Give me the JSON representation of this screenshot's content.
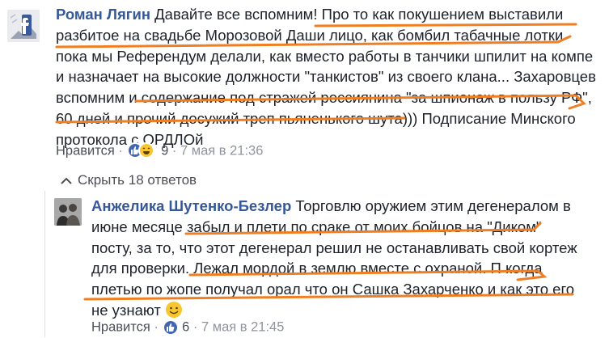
{
  "comment1": {
    "author": "Роман Лягин",
    "lines": [
      "Давайте все вспомним! Про то как покушением выставили",
      "разбитое на свадьбе Морозовой Даши лицо, как бомбил табачные лотки",
      "пока мы Референдум делали, как вместо работы в танчики шпилит на компе",
      "и назначает на высокие должности \"танкистов\" из своего клана... Захаровцев",
      "вспомним и содержание под стражей россиянина \"за шпионаж в пользу РФ\",",
      "60 дней и прочий досужий треп пьяненького шута))) Подписание Минского",
      "протокола с ОРДЛОй"
    ],
    "like_label": "Нравится",
    "reaction_count": "9",
    "separator": "·",
    "timestamp": "7 мая в 21:36"
  },
  "replies_toggle": {
    "label": "Скрыть 18 ответов"
  },
  "comment2": {
    "author": "Анжелика Шутенко-Безлер",
    "lines": [
      "Торговлю оружием этим дегенералом в",
      "июне месяце забыл и плети по сраке от моих бойцов на \"Диком\"",
      "посту, за то, что этот дегенерал решил не останавливать свой кортеж",
      "для проверки. Лежал мордой в землю вместе с охраной. П когда",
      "плетью по жопе получал орал что он Сашка Захарченко и как это его",
      "не узнают"
    ],
    "like_label": "Нравится",
    "reaction_count": "6",
    "separator": "·",
    "timestamp": "7 мая в 21:45"
  },
  "colors": {
    "name": "#365899",
    "highlight": "#f07f23",
    "meta": "#90949c",
    "like_blue": "#4267b2"
  }
}
